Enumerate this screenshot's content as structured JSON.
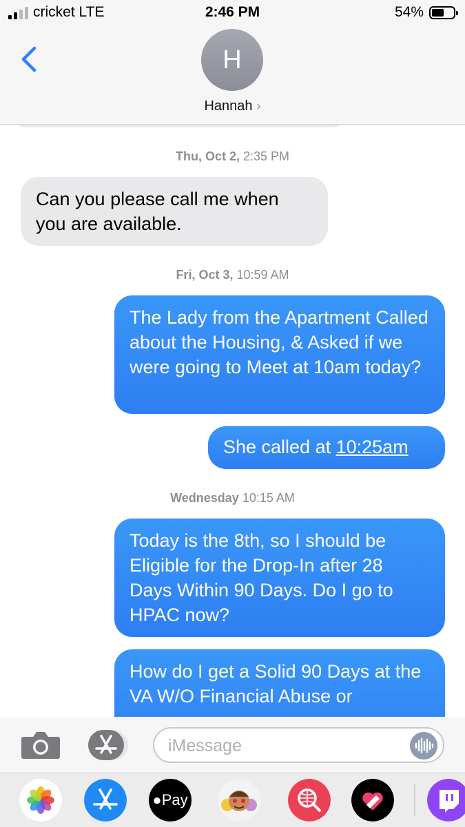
{
  "status_bar": {
    "carrier": "cricket  LTE",
    "time": "2:46 PM",
    "battery": "54%",
    "signal_bars_active": 2,
    "signal_bars_total": 4
  },
  "header": {
    "avatar_initial": "H",
    "contact_name": "Hannah",
    "chevron": "›",
    "back_icon": "chevron-left-icon"
  },
  "thread": {
    "stamps": [
      {
        "day": "Thu, Oct 2,",
        "time": "2:35 PM"
      },
      {
        "day": "Fri, Oct 3,",
        "time": "10:59 AM"
      },
      {
        "day": "Wednesday",
        "time": "10:15 AM"
      }
    ],
    "messages": [
      {
        "direction": "incoming",
        "text": "Can you please call me when you are available."
      },
      {
        "direction": "outgoing",
        "text": "The Lady from the Apartment Called about the Housing, & Asked if we were going to Meet at 10am today?"
      },
      {
        "direction": "outgoing",
        "prefix": "She called at ",
        "link": "10:25am"
      },
      {
        "direction": "outgoing",
        "text": "Today is the 8th, so I should be Eligible for the Drop-In after 28 Days Within 90 Days. Do I go to HPAC now?"
      },
      {
        "direction": "outgoing",
        "text": "How do I get a Solid 90 Days at the VA W/O Financial Abuse or"
      }
    ]
  },
  "input_bar": {
    "placeholder": "iMessage",
    "icons": [
      "camera-icon",
      "app-store-icon",
      "audio-waveform-icon"
    ]
  },
  "app_drawer": {
    "apps": [
      "photos-app-icon",
      "app-store-app-icon",
      "apple-pay-app-icon",
      "memoji-app-icon",
      "web-images-app-icon",
      "digital-touch-app-icon",
      "twitch-app-icon"
    ],
    "apple_pay_label": "Pay"
  },
  "colors": {
    "accent": "#2f83f3",
    "incoming_bubble": "#e9e9eb",
    "outgoing_bubble": "#3a8ff6",
    "timestamp": "#8e8e93"
  }
}
